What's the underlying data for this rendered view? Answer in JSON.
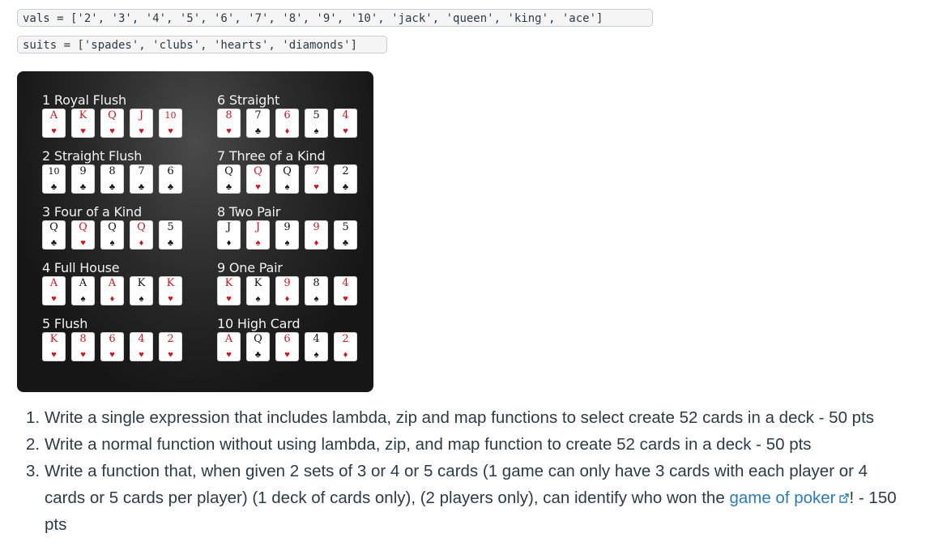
{
  "code": {
    "vals_line": "vals = ['2', '3', '4', '5', '6', '7', '8', '9', '10', 'jack', 'queen', 'king', 'ace']",
    "suits_line": "suits = ['spades', 'clubs', 'hearts', 'diamonds']"
  },
  "poker_hands": [
    {
      "title": "1  Royal Flush",
      "cards": [
        [
          "A",
          "♥",
          "r"
        ],
        [
          "K",
          "♥",
          "r"
        ],
        [
          "Q",
          "♥",
          "r"
        ],
        [
          "J",
          "♥",
          "r"
        ],
        [
          "10",
          "♥",
          "r"
        ]
      ]
    },
    {
      "title": "2  Straight Flush",
      "cards": [
        [
          "10",
          "♣",
          "b"
        ],
        [
          "9",
          "♣",
          "b"
        ],
        [
          "8",
          "♣",
          "b"
        ],
        [
          "7",
          "♣",
          "b"
        ],
        [
          "6",
          "♣",
          "b"
        ]
      ]
    },
    {
      "title": "3  Four of a Kind",
      "cards": [
        [
          "Q",
          "♣",
          "b"
        ],
        [
          "Q",
          "♥",
          "r"
        ],
        [
          "Q",
          "♠",
          "b"
        ],
        [
          "Q",
          "♦",
          "r"
        ],
        [
          "5",
          "♣",
          "b"
        ]
      ]
    },
    {
      "title": "4  Full House",
      "cards": [
        [
          "A",
          "♥",
          "r"
        ],
        [
          "A",
          "♠",
          "b"
        ],
        [
          "A",
          "♦",
          "r"
        ],
        [
          "K",
          "♠",
          "b"
        ],
        [
          "K",
          "♥",
          "r"
        ]
      ]
    },
    {
      "title": "5  Flush",
      "cards": [
        [
          "K",
          "♥",
          "r"
        ],
        [
          "8",
          "♥",
          "r"
        ],
        [
          "6",
          "♥",
          "r"
        ],
        [
          "4",
          "♥",
          "r"
        ],
        [
          "2",
          "♥",
          "r"
        ]
      ]
    },
    {
      "title": "6  Straight",
      "cards": [
        [
          "8",
          "♥",
          "r"
        ],
        [
          "7",
          "♣",
          "b"
        ],
        [
          "6",
          "♦",
          "r"
        ],
        [
          "5",
          "♠",
          "b"
        ],
        [
          "4",
          "♥",
          "r"
        ]
      ]
    },
    {
      "title": "7  Three of a Kind",
      "cards": [
        [
          "Q",
          "♣",
          "b"
        ],
        [
          "Q",
          "♥",
          "r"
        ],
        [
          "Q",
          "♠",
          "b"
        ],
        [
          "7",
          "♥",
          "r"
        ],
        [
          "2",
          "♣",
          "b"
        ]
      ]
    },
    {
      "title": "8  Two Pair",
      "cards": [
        [
          "J",
          "♦",
          "b"
        ],
        [
          "J",
          "♠",
          "r"
        ],
        [
          "9",
          "♠",
          "b"
        ],
        [
          "9",
          "♦",
          "r"
        ],
        [
          "5",
          "♣",
          "b"
        ]
      ]
    },
    {
      "title": "9  One Pair",
      "cards": [
        [
          "K",
          "♥",
          "r"
        ],
        [
          "K",
          "♠",
          "b"
        ],
        [
          "9",
          "♦",
          "r"
        ],
        [
          "8",
          "♠",
          "b"
        ],
        [
          "4",
          "♥",
          "r"
        ]
      ]
    },
    {
      "title": "10  High Card",
      "cards": [
        [
          "A",
          "♥",
          "r"
        ],
        [
          "Q",
          "♣",
          "b"
        ],
        [
          "6",
          "♥",
          "r"
        ],
        [
          "4",
          "♠",
          "b"
        ],
        [
          "2",
          "♦",
          "r"
        ]
      ]
    }
  ],
  "tasks": [
    {
      "number": "1.",
      "text": "Write a single expression that includes lambda, zip and map functions to select create 52 cards in a deck - 50 pts"
    },
    {
      "number": "2.",
      "text": "Write a normal function without using lambda, zip, and map function to create 52 cards in a deck - 50 pts"
    },
    {
      "number": "3.",
      "text_before": "Write a function that, when given 2 sets of 3 or 4 or 5 cards (1 game can only have 3 cards with each player or 4 cards or 5 cards per player) (1 deck of cards only), (2 players only), can identify who won the ",
      "link_text": "game of poker",
      "text_after": "! - 150 pts"
    }
  ],
  "colors": {
    "link": "#2b7abc",
    "red_suit": "#d6141e",
    "black_suit": "#111111"
  },
  "icons": {
    "external_link": "external-link-icon"
  }
}
